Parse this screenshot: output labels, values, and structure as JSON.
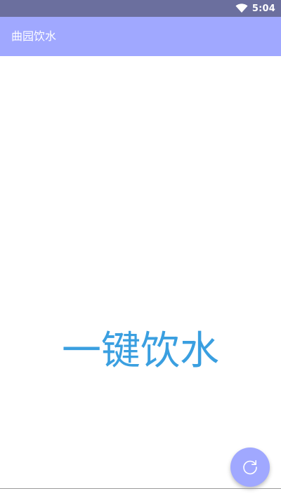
{
  "status_bar": {
    "time": "5:04",
    "icons": [
      "wifi-icon"
    ]
  },
  "app_bar": {
    "title": "曲园饮水"
  },
  "main": {
    "action_label": "一键饮水"
  },
  "fab": {
    "icon": "refresh-icon"
  },
  "colors": {
    "status_bar": "#6b6f9e",
    "app_bar": "#a0a8ff",
    "accent_text": "#3a9fe0",
    "fab": "#a0a8ff"
  }
}
